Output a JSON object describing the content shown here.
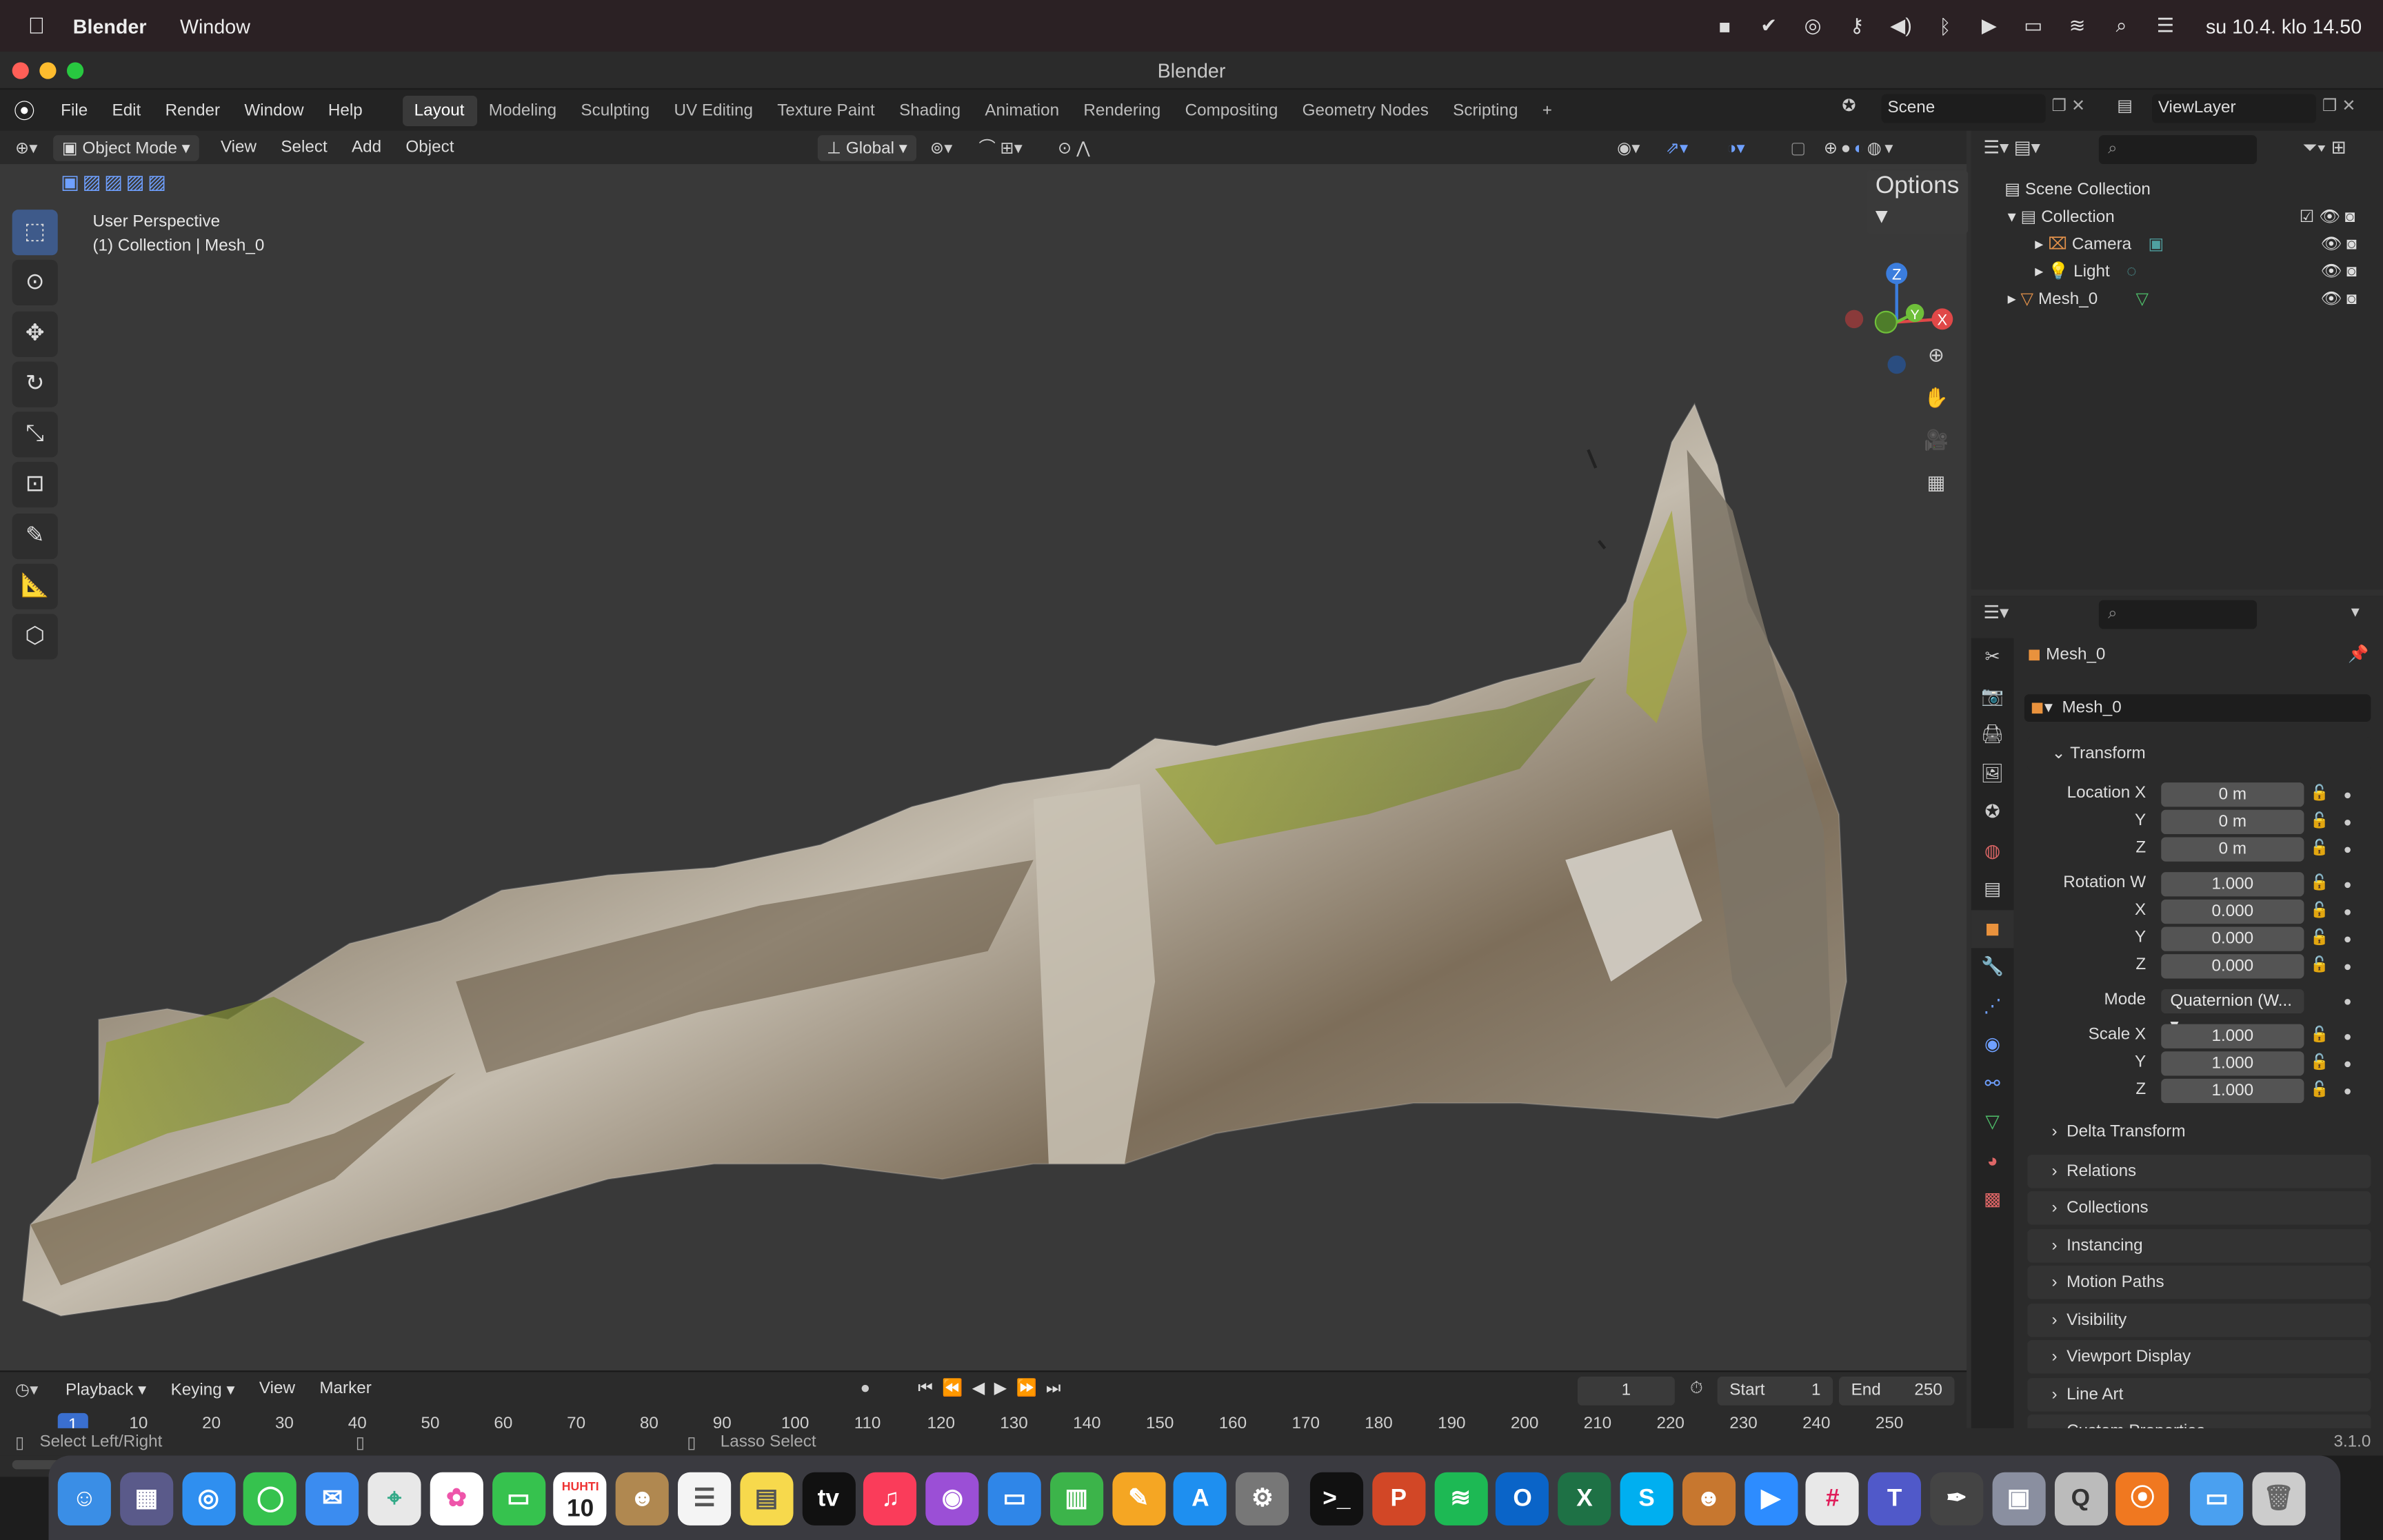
{
  "macos_menubar": {
    "app_name": "Blender",
    "menu": "Window",
    "clock": "su 10.4. klo 14.50"
  },
  "window": {
    "title": "Blender"
  },
  "blender_menu": [
    "File",
    "Edit",
    "Render",
    "Window",
    "Help"
  ],
  "workspaces": [
    {
      "label": "Layout",
      "active": true
    },
    {
      "label": "Modeling"
    },
    {
      "label": "Sculpting"
    },
    {
      "label": "UV Editing"
    },
    {
      "label": "Texture Paint"
    },
    {
      "label": "Shading"
    },
    {
      "label": "Animation"
    },
    {
      "label": "Rendering"
    },
    {
      "label": "Compositing"
    },
    {
      "label": "Geometry Nodes"
    },
    {
      "label": "Scripting"
    }
  ],
  "scene": {
    "name": "Scene",
    "view_layer": "ViewLayer"
  },
  "viewport": {
    "mode": "Object Mode",
    "menus": [
      "View",
      "Select",
      "Add",
      "Object"
    ],
    "orientation": "Global",
    "options_label": "Options",
    "overlay_line1": "User Perspective",
    "overlay_line2": "(1) Collection | Mesh_0",
    "gizmo_axes": {
      "x": "X",
      "y": "Y",
      "z": "Z"
    }
  },
  "outliner": {
    "root": "Scene Collection",
    "collection": "Collection",
    "items": [
      {
        "label": "Camera"
      },
      {
        "label": "Light"
      },
      {
        "label": "Mesh_0"
      }
    ]
  },
  "properties": {
    "object_name": "Mesh_0",
    "data_name": "Mesh_0",
    "transform_label": "Transform",
    "location": {
      "label": "Location X",
      "x": "0 m",
      "y": "0 m",
      "z": "0 m"
    },
    "rotation": {
      "label": "Rotation W",
      "w": "1.000",
      "x": "0.000",
      "y": "0.000",
      "z": "0.000"
    },
    "mode": {
      "label": "Mode",
      "value": "Quaternion (W..."
    },
    "scale": {
      "label": "Scale X",
      "x": "1.000",
      "y": "1.000",
      "z": "1.000"
    },
    "axis_labels": {
      "x": "X",
      "y": "Y",
      "z": "Z"
    },
    "delta": "Delta Transform",
    "sections": [
      "Relations",
      "Collections",
      "Instancing",
      "Motion Paths",
      "Visibility",
      "Viewport Display",
      "Line Art",
      "Custom Properties"
    ]
  },
  "timeline": {
    "menus": [
      "Playback",
      "Keying",
      "View",
      "Marker"
    ],
    "current_frame": "1",
    "start_label": "Start",
    "start": "1",
    "end_label": "End",
    "end": "250",
    "ruler": [
      "1",
      "10",
      "20",
      "30",
      "40",
      "50",
      "60",
      "70",
      "80",
      "90",
      "100",
      "110",
      "120",
      "130",
      "140",
      "150",
      "160",
      "170",
      "180",
      "190",
      "200",
      "210",
      "220",
      "230",
      "240",
      "250"
    ]
  },
  "statusbar": {
    "left": "Select Left/Right",
    "mid": "Lasso Select",
    "version": "3.1.0"
  },
  "dock": {
    "calendar_month": "HUHTI",
    "calendar_day": "10"
  }
}
